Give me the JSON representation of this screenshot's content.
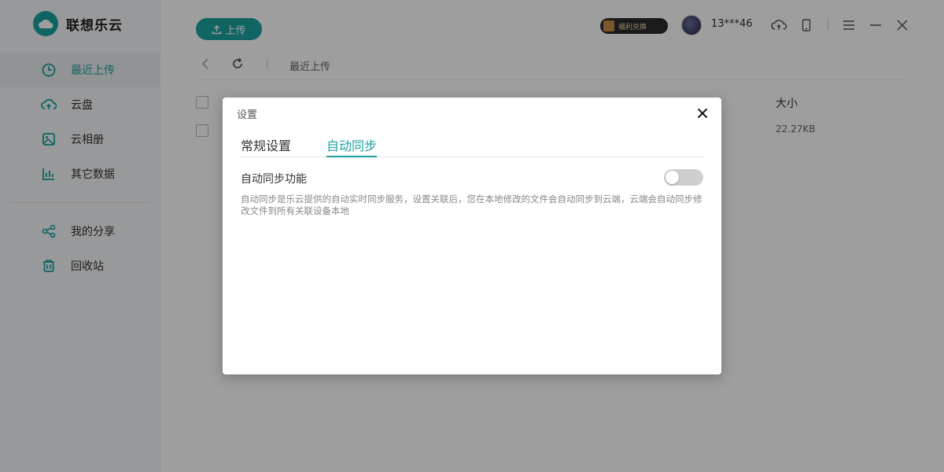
{
  "app": {
    "title": "联想乐云"
  },
  "sidebar": {
    "items": [
      {
        "label": "最近上传",
        "icon": "clock-icon",
        "active": true
      },
      {
        "label": "云盘",
        "icon": "cloud-upload-icon",
        "active": false
      },
      {
        "label": "云相册",
        "icon": "image-icon",
        "active": false
      },
      {
        "label": "其它数据",
        "icon": "bar-chart-icon",
        "active": false
      }
    ],
    "items2": [
      {
        "label": "我的分享",
        "icon": "share-icon"
      },
      {
        "label": "回收站",
        "icon": "trash-icon"
      }
    ]
  },
  "header": {
    "upload_label": "上传",
    "promo_label": "福利兑换",
    "username": "13***46"
  },
  "toolbar": {
    "breadcrumb": "最近上传"
  },
  "table": {
    "size_header": "大小",
    "rows": [
      {
        "size": "22.27KB"
      }
    ]
  },
  "modal": {
    "title": "设置",
    "tabs": [
      {
        "label": "常规设置",
        "active": false
      },
      {
        "label": "自动同步",
        "active": true
      }
    ],
    "setting_label": "自动同步功能",
    "toggle_on": false,
    "description": "自动同步是乐云提供的自动实时同步服务，设置关联后，您在本地修改的文件会自动同步到云端，云端会自动同步修改文件到所有关联设备本地"
  },
  "colors": {
    "accent": "#1aa3a0"
  }
}
